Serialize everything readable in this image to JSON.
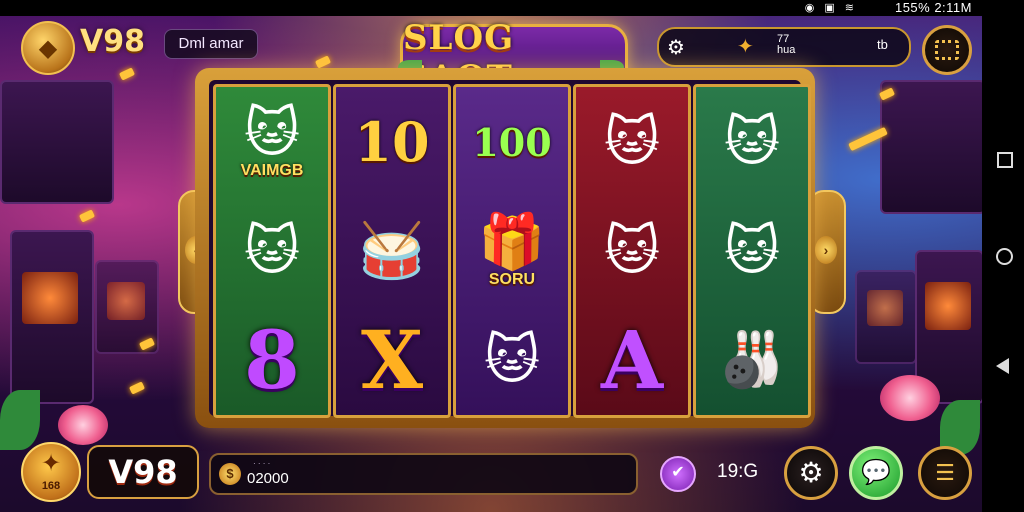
{
  "status_bar": {
    "text": "155% 2:11M",
    "icons": [
      "sync-icon",
      "image-icon",
      "wifi-icon"
    ]
  },
  "brand": {
    "top": "V98",
    "bottom": "V98"
  },
  "player": {
    "name": "Dml amar"
  },
  "game": {
    "title": "SLOG SAOT"
  },
  "top_pill": {
    "small_text": "77\nhua",
    "right_text": "tb"
  },
  "reels": [
    [
      {
        "type": "emoji",
        "glyph": "🐱",
        "label": "VAIMGB"
      },
      {
        "type": "emoji",
        "glyph": "🐱",
        "label": ""
      },
      {
        "type": "letter",
        "glyph": "8",
        "label": ""
      }
    ],
    [
      {
        "type": "text",
        "glyph": "",
        "label": "10"
      },
      {
        "type": "emoji",
        "glyph": "🥁",
        "label": ""
      },
      {
        "type": "letter",
        "glyph": "X",
        "label": ""
      }
    ],
    [
      {
        "type": "text",
        "glyph": "",
        "label": "100"
      },
      {
        "type": "emoji",
        "glyph": "🎁",
        "label": "SORU"
      },
      {
        "type": "emoji",
        "glyph": "🐱",
        "label": ""
      }
    ],
    [
      {
        "type": "emoji",
        "glyph": "🐱",
        "label": ""
      },
      {
        "type": "emoji",
        "glyph": "🐱",
        "label": ""
      },
      {
        "type": "letter",
        "glyph": "A",
        "label": ""
      }
    ],
    [
      {
        "type": "emoji",
        "glyph": "🐱",
        "label": ""
      },
      {
        "type": "emoji",
        "glyph": "🐱",
        "label": ""
      },
      {
        "type": "emoji",
        "glyph": "🎳",
        "label": ""
      }
    ]
  ],
  "bottom": {
    "coin_label": "168",
    "balance_caption": "· · · ·",
    "balance_value": "02000",
    "bet_value": "19:G"
  },
  "colors": {
    "gold": "#d8a03c",
    "reel_green": "#2f7a3a",
    "reel_purple": "#3c1a5a",
    "reel_red": "#8a1a2a"
  }
}
